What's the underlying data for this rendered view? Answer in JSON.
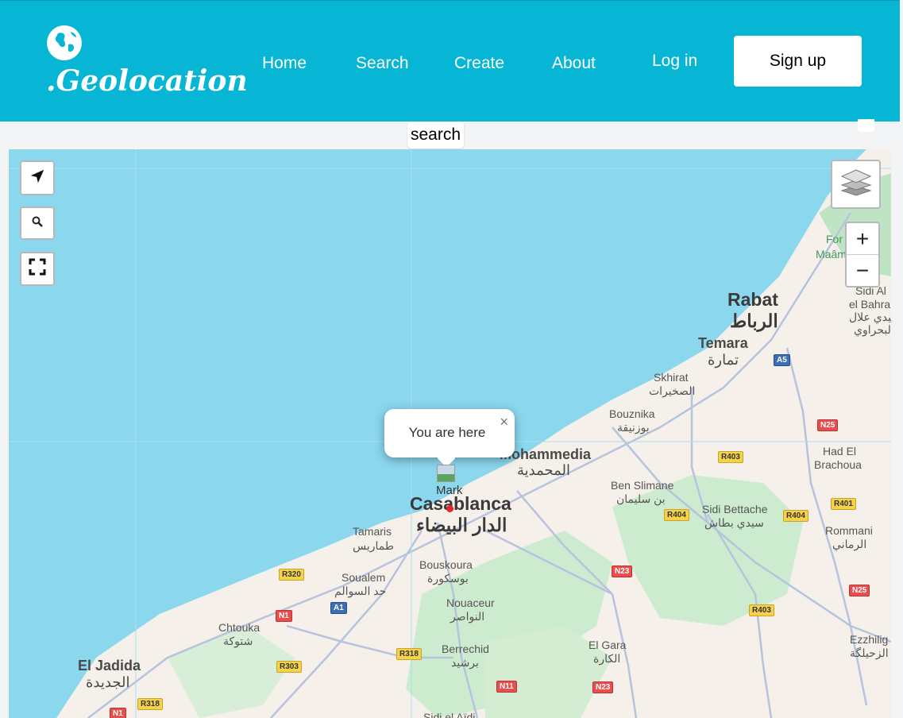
{
  "brand": {
    "logo_text": ".Geolocation",
    "logo_icon": "globe-icon"
  },
  "nav": {
    "home": "Home",
    "search": "Search",
    "create": "Create",
    "about": "About",
    "login": "Log in",
    "signup": "Sign up"
  },
  "search_tag": "search",
  "map": {
    "controls": {
      "locate_icon": "navigation-arrow-icon",
      "search_icon": "search-icon",
      "fullscreen_icon": "fullscreen-icon",
      "layers_icon": "layers-icon",
      "zoom_in": "+",
      "zoom_out": "−"
    },
    "popup": {
      "text": "You are here",
      "close": "×"
    },
    "marker_alt": "Marker",
    "cities": {
      "rabat": "Rabat",
      "rabat_ar": "الرباط",
      "temara": "Temara",
      "temara_ar": "تمارة",
      "skhirat": "Skhirat",
      "skhirat_ar": "الصخيرات",
      "bouznika": "Bouznika",
      "bouznika_ar": "بوزنيقة",
      "mohammedia": "Mohammedia",
      "mohammedia_ar": "المحمدية",
      "casablanca": "Casablanca",
      "casablanca_ar": "الدار البيضاء",
      "tamaris": "Tamaris",
      "tamaris_ar": "طماريس",
      "soualem": "Soualem",
      "soualem_ar": "حد السوالم",
      "bouskoura": "Bouskoura",
      "bouskoura_ar": "بوسكورة",
      "nouaceur": "Nouaceur",
      "nouaceur_ar": "النواصر",
      "berrechid": "Berrechid",
      "berrechid_ar": "برشيد",
      "chtouka": "Chtouka",
      "chtouka_ar": "شتوكة",
      "eljadida": "El Jadida",
      "eljadida_ar": "الجديدة",
      "bensliman": "Ben Slimane",
      "bensliman_ar": "بن سليمان",
      "sidibettache": "Sidi Bettache",
      "sidibettache_ar": "سيدي بطاش",
      "elgara": "El Gara",
      "elgara_ar": "الكارة",
      "hadbrachoua": "Had El",
      "hadbrachoua2": "Brachoua",
      "rommani": "Rommani",
      "rommani_ar": "الرماني",
      "ezzhiliga": "Ezzhilig",
      "ezzhiliga_ar": "الزحيلگة",
      "sidiallal": "Sidi Al",
      "elbahra": "el Bahra",
      "sidiallal_ar": "سيدي علال",
      "elbahra_ar": "البحراوي",
      "foret": "For",
      "maamora": "Maâm",
      "sidiaidi": "Sidi el Aïdi"
    },
    "roads": [
      "A5",
      "N25",
      "R403",
      "R401",
      "R404",
      "R404",
      "N23",
      "N25",
      "R403",
      "R320",
      "A1",
      "N1",
      "R303",
      "R318",
      "R318",
      "N11",
      "N23",
      "N1"
    ]
  },
  "colors": {
    "header": "#07b6d5",
    "water": "#8bd7ee",
    "land": "#f5f1ea",
    "green": "#cdeccf"
  }
}
